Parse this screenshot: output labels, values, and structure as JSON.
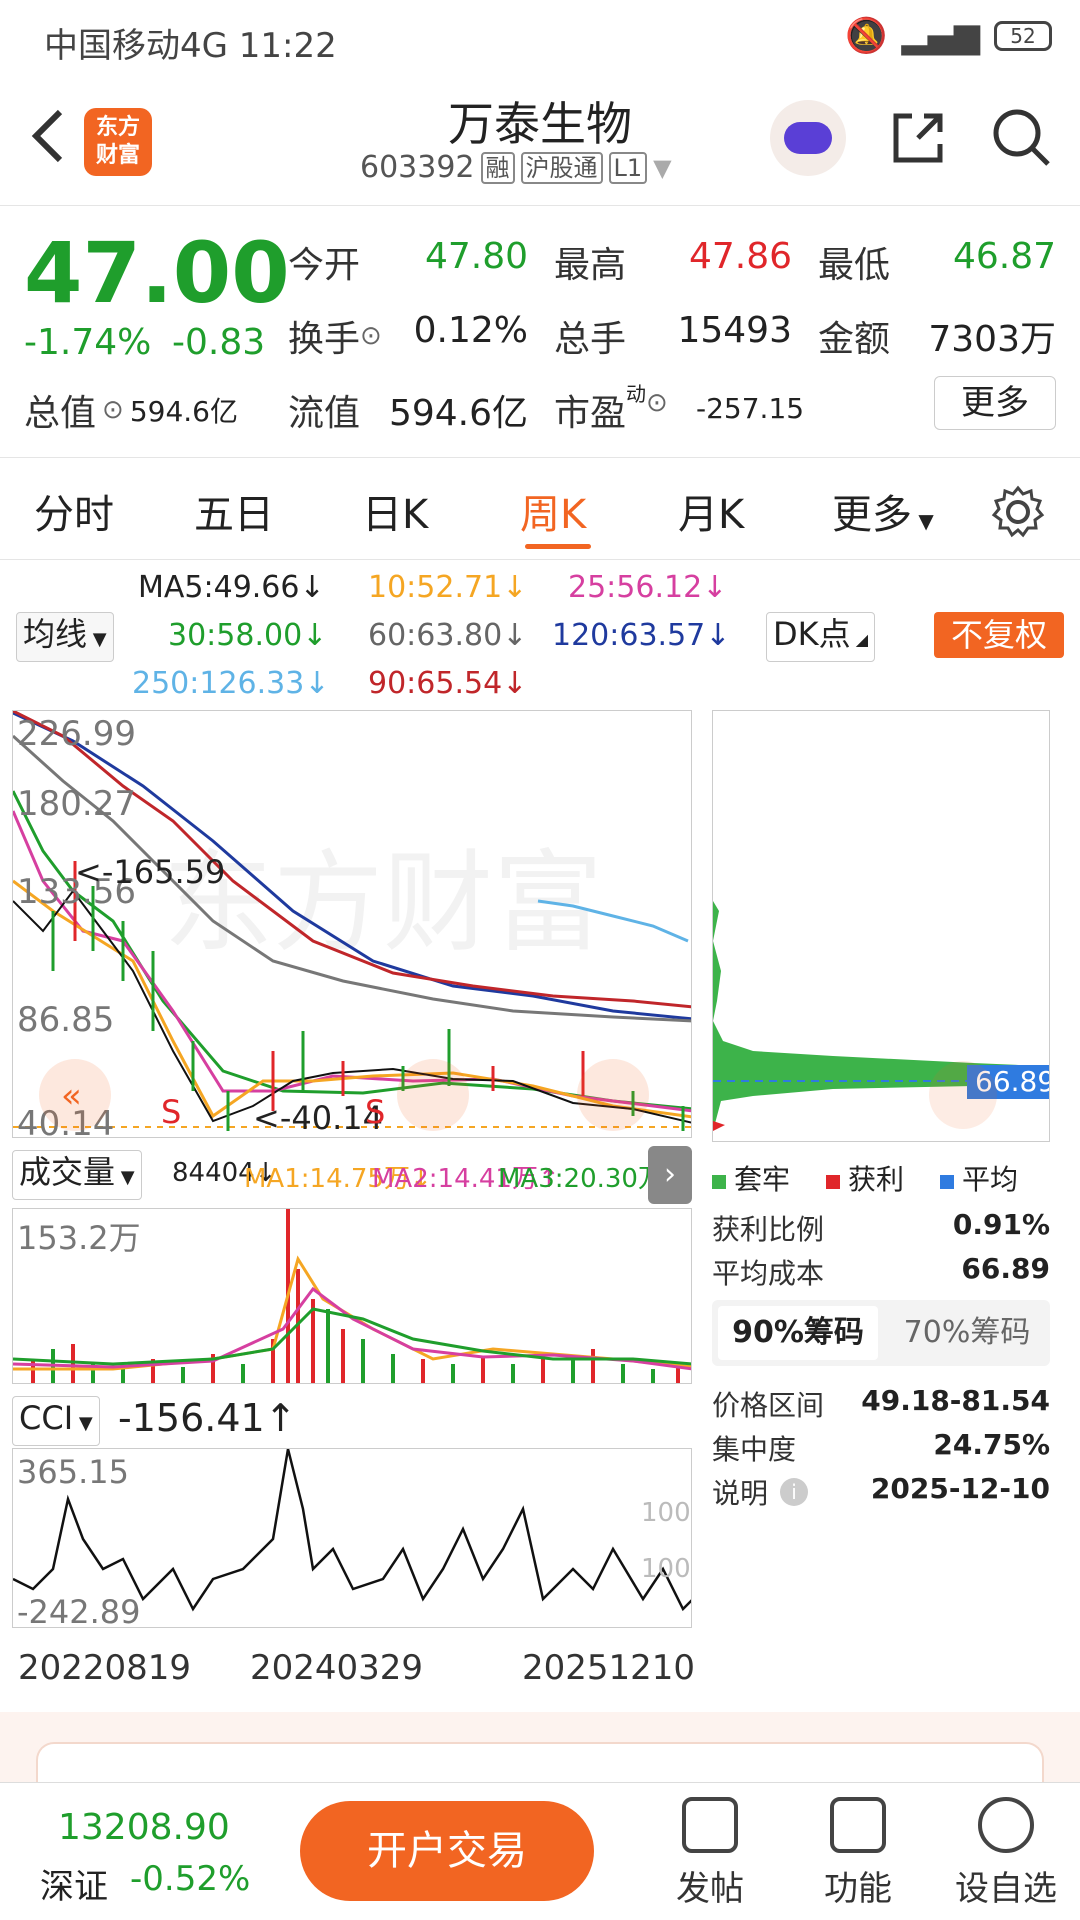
{
  "status": {
    "carrier": "中国移动4G",
    "time": "11:22",
    "battery": "52"
  },
  "header": {
    "logo": "东方财富",
    "name": "万泰生物",
    "code": "603392",
    "tags": [
      "融",
      "沪股通",
      "L1"
    ]
  },
  "quote": {
    "price": "47.00",
    "pct": "-1.74%",
    "chg": "-0.83",
    "open_lbl": "今开",
    "open": "47.80",
    "high_lbl": "最高",
    "high": "47.86",
    "low_lbl": "最低",
    "low": "46.87",
    "turnover_lbl": "换手",
    "turnover": "0.12%",
    "volume_lbl": "总手",
    "volume": "15493",
    "amount_lbl": "金额",
    "amount": "7303万",
    "mcap_lbl": "总值",
    "mcap": "594.6亿",
    "float_lbl": "流值",
    "float": "594.6亿",
    "pe_lbl": "市盈",
    "pe_sup": "动",
    "pe": "-257.15",
    "more": "更多"
  },
  "tabs": [
    "分时",
    "五日",
    "日K",
    "周K",
    "月K",
    "更多"
  ],
  "ma": {
    "selector": "均线",
    "ma5": "MA5:49.66↓",
    "ma10": "10:52.71↓",
    "ma25": "25:56.12↓",
    "ma30": "30:58.00↓",
    "ma60": "60:63.80↓",
    "ma120": "120:63.57↓",
    "ma250": "250:126.33↓",
    "ma90": "90:65.54↓",
    "dk": "DK点",
    "adjust": "不复权"
  },
  "kchart": {
    "yticks": [
      "226.99",
      "180.27",
      "133.56",
      "86.85",
      "40.14"
    ],
    "max_note": "<-165.59",
    "min_note": "<-40.14",
    "colors": {
      "ma5": "#111111",
      "ma10": "#f5a623",
      "ma25": "#d63fa0",
      "ma30": "#1f9e2c",
      "ma60": "#777777",
      "ma120": "#1f3a9e",
      "ma250": "#5fb3e6",
      "ma90": "#c0262a"
    }
  },
  "volume": {
    "selector": "成交量",
    "value": "84404↓",
    "ma1": "MA1:14.75万↓",
    "ma2": "MA2:14.41万↑",
    "ma3": "MA3:20.30万↓",
    "ytop": "153.2万"
  },
  "cci": {
    "selector": "CCI",
    "value": "-156.41↑",
    "ytop": "365.15",
    "ybot": "-242.89",
    "l100": "100",
    "l_100": "100"
  },
  "xaxis": [
    "20220819",
    "20240329",
    "20251210"
  ],
  "chips": {
    "avg_price_tag": "66.89",
    "legend": [
      {
        "label": "套牢",
        "color": "#3db34a"
      },
      {
        "label": "获利",
        "color": "#e0262a"
      },
      {
        "label": "平均",
        "color": "#2f7be0"
      }
    ],
    "profit_lbl": "获利比例",
    "profit": "0.91%",
    "avgcost_lbl": "平均成本",
    "avgcost": "66.89",
    "tab90": "90%筹码",
    "tab70": "70%筹码",
    "range_lbl": "价格区间",
    "range": "49.18-81.54",
    "conc_lbl": "集中度",
    "conc": "24.75%",
    "note_lbl": "说明",
    "note": "2025-12-10"
  },
  "bottom": {
    "index_value": "13208.90",
    "index_name": "深证",
    "index_pct": "-0.52%",
    "trade": "开户交易",
    "post": "发帖",
    "func": "功能",
    "watch": "设自选"
  }
}
